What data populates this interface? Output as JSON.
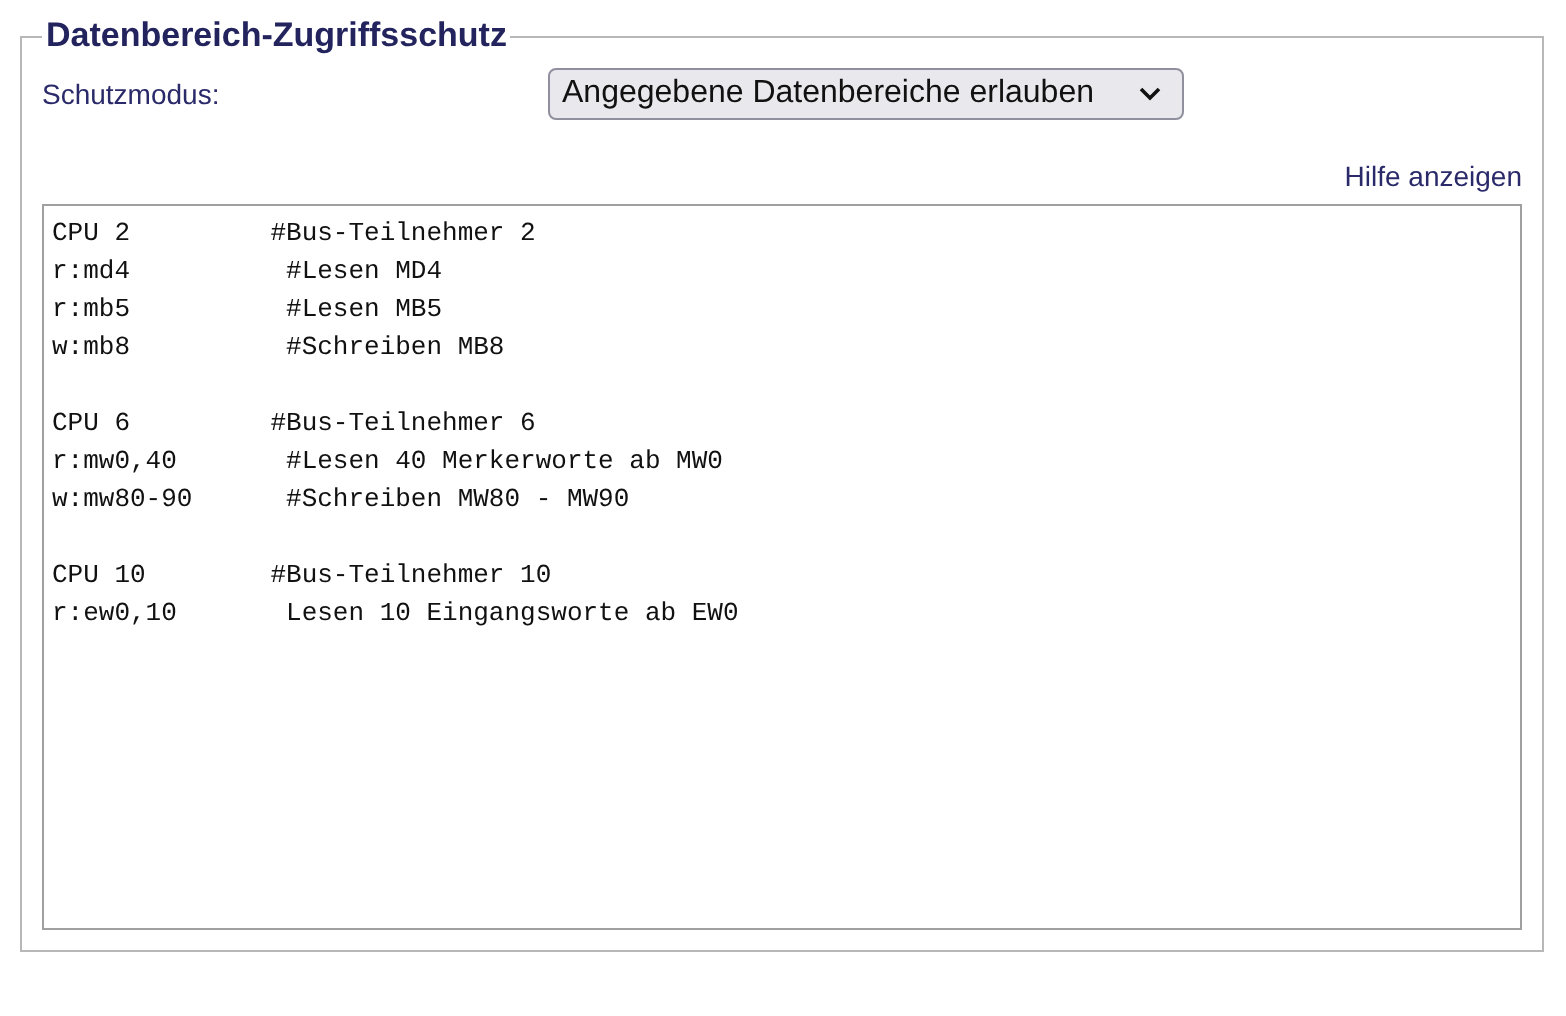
{
  "section": {
    "title": "Datenbereich-Zugriffsschutz"
  },
  "mode": {
    "label": "Schutzmodus:",
    "value": "Angegebene Datenbereiche erlauben"
  },
  "help_link": "Hilfe anzeigen",
  "editor": {
    "value": "CPU 2         #Bus-Teilnehmer 2\nr:md4          #Lesen MD4\nr:mb5          #Lesen MB5\nw:mb8          #Schreiben MB8\n\nCPU 6         #Bus-Teilnehmer 6\nr:mw0,40       #Lesen 40 Merkerworte ab MW0\nw:mw80-90      #Schreiben MW80 - MW90\n\nCPU 10        #Bus-Teilnehmer 10\nr:ew0,10       Lesen 10 Eingangsworte ab EW0"
  }
}
